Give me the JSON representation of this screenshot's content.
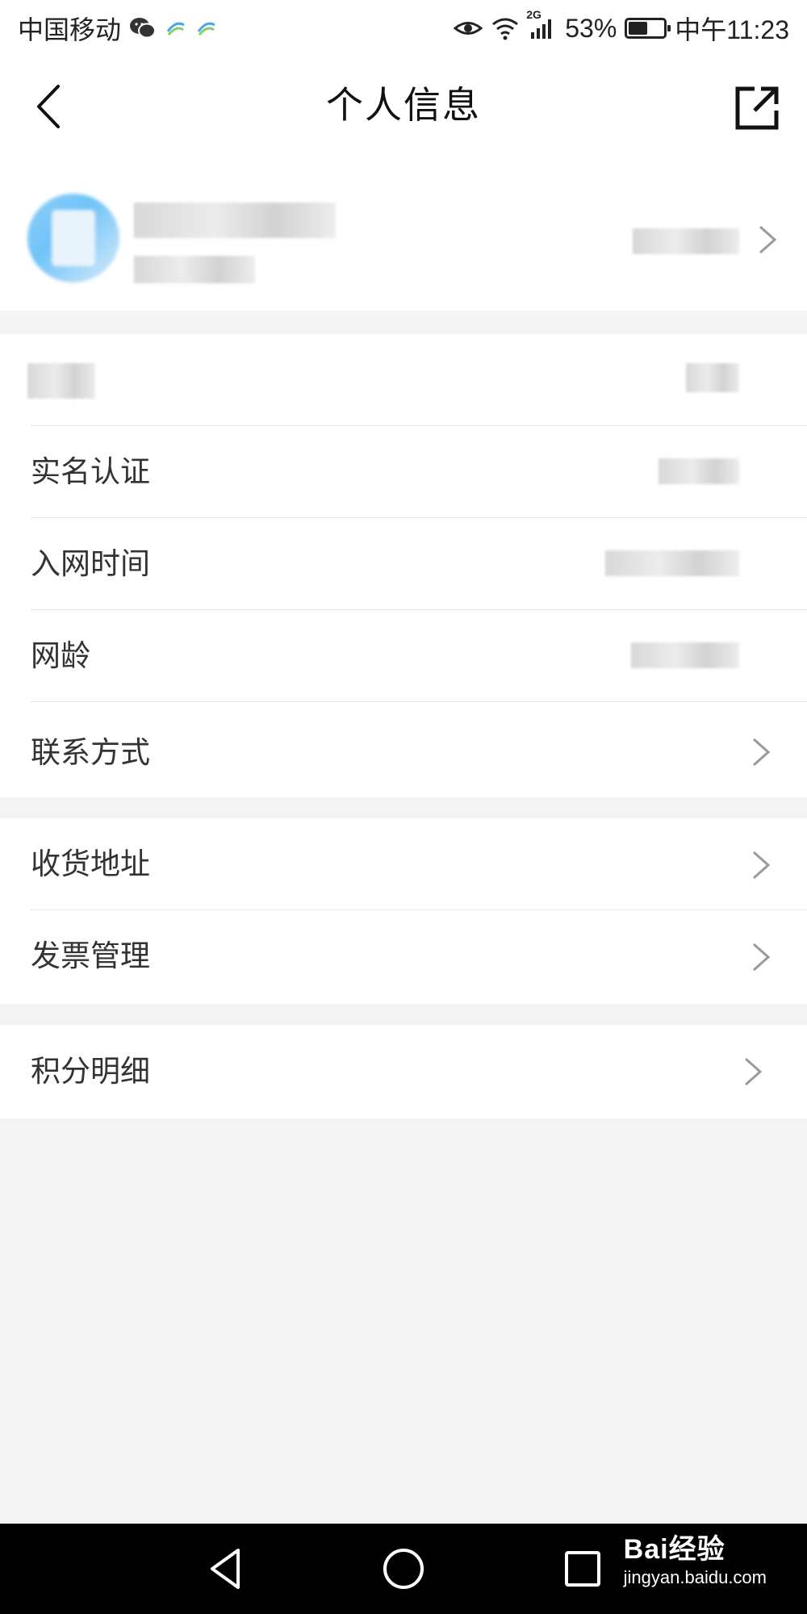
{
  "status_bar": {
    "carrier": "中国移动",
    "network": "2G",
    "battery": "53%",
    "battery_level": 0.53,
    "time": "中午11:23"
  },
  "header": {
    "title": "个人信息",
    "back_icon": "chevron-left-icon",
    "share_icon": "share-external-icon"
  },
  "profile": {
    "avatar": "avatar-blurred"
  },
  "sections": [
    {
      "rows": [
        {
          "label": "",
          "has_chevron": false,
          "blurred": true
        },
        {
          "label": "实名认证",
          "has_chevron": false
        },
        {
          "label": "入网时间",
          "has_chevron": false
        },
        {
          "label": "网龄",
          "has_chevron": false
        },
        {
          "label": "联系方式",
          "has_chevron": true
        }
      ]
    },
    {
      "rows": [
        {
          "label": "收货地址",
          "has_chevron": true
        },
        {
          "label": "发票管理",
          "has_chevron": true
        }
      ]
    },
    {
      "rows": [
        {
          "label": "积分明细",
          "has_chevron": true
        }
      ]
    }
  ],
  "nav_bar": {
    "back": "triangle-back-icon",
    "home": "circle-home-icon",
    "recents": "square-recents-icon"
  },
  "watermark": {
    "main": "Bai经验",
    "sub": "jingyan.baidu.com"
  },
  "colors": {
    "background": "#f4f4f4",
    "surface": "#ffffff",
    "text": "#333333",
    "chevron": "#9a9a9a",
    "nav_bar": "#000000"
  }
}
